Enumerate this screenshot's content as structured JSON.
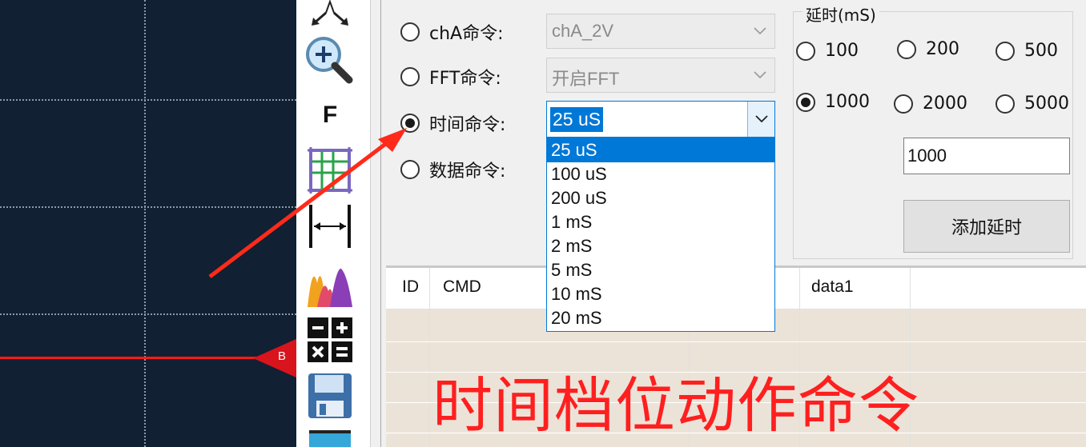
{
  "scope": {
    "marker_label": "B",
    "trace_color": "#ff1a1a"
  },
  "toolbar": {
    "items": [
      {
        "icon": "move-arrows-icon"
      },
      {
        "icon": "zoom-in-icon"
      },
      {
        "icon": "f-text-icon",
        "text": "F"
      },
      {
        "icon": "grid-icon"
      },
      {
        "icon": "horizontal-measure-icon"
      },
      {
        "icon": "spectrum-icon"
      },
      {
        "icon": "calculator-icon"
      },
      {
        "icon": "save-icon"
      },
      {
        "icon": "screen-icon"
      }
    ]
  },
  "commands": {
    "cha": {
      "label": "chA命令:",
      "value": "chA_2V",
      "checked": false
    },
    "fft": {
      "label": "FFT命令:",
      "value": "开启FFT",
      "checked": false
    },
    "time": {
      "label": "时间命令:",
      "value": "25 uS",
      "checked": true
    },
    "data": {
      "label": "数据命令:",
      "checked": false
    }
  },
  "time_dropdown": {
    "options": [
      "25 uS",
      "100 uS",
      "200 uS",
      "1 mS",
      "2 mS",
      "5 mS",
      "10 mS",
      "20 mS"
    ],
    "selected": "25 uS"
  },
  "delay": {
    "title": "延时(mS)",
    "options": [
      {
        "label": "100",
        "checked": false
      },
      {
        "label": "200",
        "checked": false
      },
      {
        "label": "500",
        "checked": false
      },
      {
        "label": "1000",
        "checked": true
      },
      {
        "label": "2000",
        "checked": false
      },
      {
        "label": "5000",
        "checked": false
      }
    ],
    "input_value": "1000",
    "add_button": "添加延时"
  },
  "table": {
    "headers": [
      "ID",
      "CMD",
      "data1"
    ]
  },
  "annotation": "时间档位动作命令",
  "colors": {
    "accent": "#0078d7",
    "annotation": "#ff1f1f",
    "scope_bg": "#112033"
  }
}
